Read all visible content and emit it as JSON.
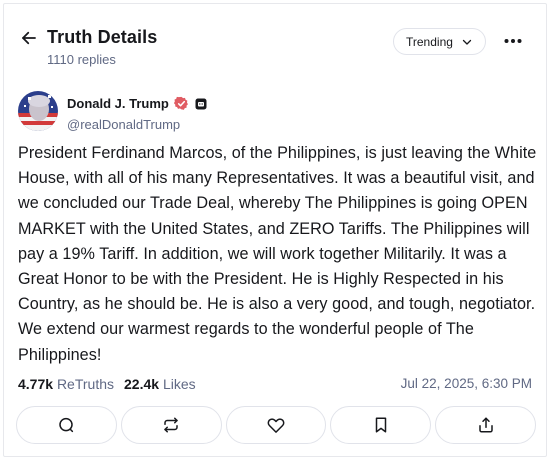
{
  "header": {
    "title": "Truth Details",
    "reply_count": "1110 replies",
    "sort_label": "Trending"
  },
  "post": {
    "author": {
      "name": "Donald J. Trump",
      "handle": "@realDonaldTrump"
    },
    "text": "President Ferdinand Marcos, of the Philippines, is just leaving the White House, with all of his many Representatives. It was a beautiful visit, and we concluded our Trade Deal, whereby The Philippines is going OPEN MARKET with the United States, and ZERO Tariffs. The Philippines will pay a 19% Tariff. In addition, we will work together Militarily. It was a Great Honor to be with the President. He is Highly Respected in his Country, as he should be. He is also a very good, and tough, negotiator. We extend our warmest regards to the wonderful people of The Philippines!",
    "stats": {
      "retruths_count": "4.77k",
      "retruths_label": "ReTruths",
      "likes_count": "22.4k",
      "likes_label": "Likes"
    },
    "timestamp": "Jul 22, 2025, 6:30 PM"
  },
  "icons": {
    "back": "arrow-left-icon",
    "sort_chevron": "chevron-down-icon",
    "more": "more-horizontal-icon",
    "verified": "verified-badge-icon",
    "automated": "bot-icon",
    "actions": [
      "reply-icon",
      "retruth-icon",
      "like-icon",
      "bookmark-icon",
      "share-icon"
    ]
  },
  "colors": {
    "text": "#17181c",
    "muted": "#606984",
    "border": "#e1e3ea",
    "verified_badge": "#e05c63"
  }
}
